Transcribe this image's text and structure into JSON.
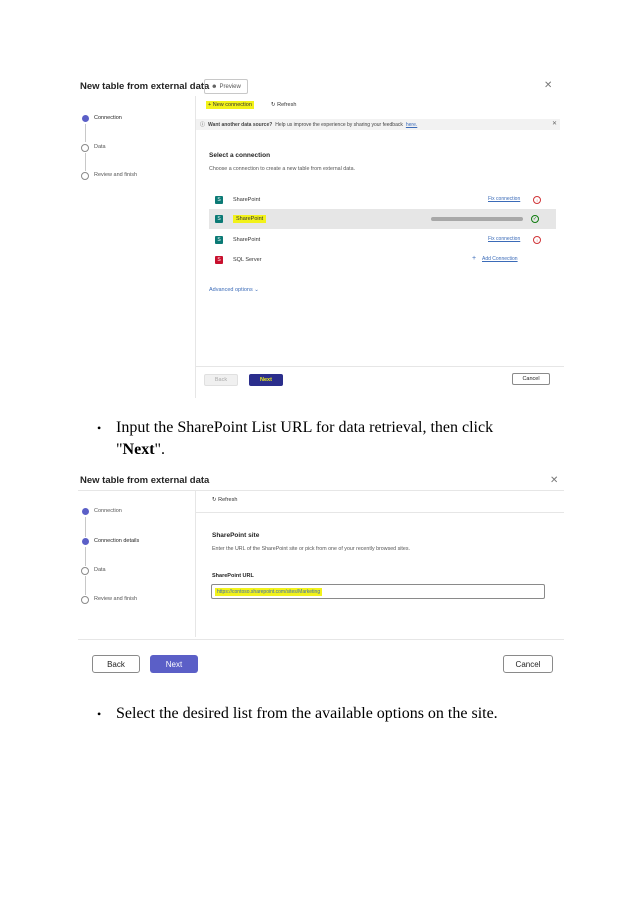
{
  "screenshot1": {
    "title": "New table from external data",
    "preview_label": "Preview",
    "steps": [
      "Connection",
      "Data",
      "Review and finish"
    ],
    "toolbar": {
      "new_connection": "New connection",
      "refresh": "Refresh"
    },
    "banner": {
      "bold": "Want another data source?",
      "text": "Help us improve the experience by sharing your feedback",
      "link": "here."
    },
    "select_title": "Select a connection",
    "select_subtitle": "Choose a connection to create a new table from external data.",
    "connections": [
      {
        "name": "SharePoint",
        "action": "Fix connection",
        "status": "error"
      },
      {
        "name": "SharePoint",
        "action": "",
        "status": "ok"
      },
      {
        "name": "SharePoint",
        "action": "Fix connection",
        "status": "error"
      },
      {
        "name": "SQL Server",
        "action": "Add Connection",
        "status": "add"
      }
    ],
    "advanced_options": "Advanced options",
    "back": "Back",
    "next": "Next",
    "cancel": "Cancel"
  },
  "bullets": [
    {
      "before": "Input the SharePoint List URL for data retrieval, then click",
      "line2_quote_open": "\"",
      "bold": "Next",
      "line2_quote_close": "\"."
    },
    {
      "text": "Select the desired list from the available options on the site."
    }
  ],
  "screenshot2": {
    "title": "New table from external data",
    "steps": [
      "Connection",
      "Connection details",
      "Data",
      "Review and finish"
    ],
    "refresh": "Refresh",
    "site_title": "SharePoint site",
    "site_subtitle": "Enter the URL of the SharePoint site or pick from one of your recently browsed sites.",
    "url_label": "SharePoint URL",
    "url_value": "https://contoso.sharepoint.com/sites/Marketing",
    "back": "Back",
    "next": "Next",
    "cancel": "Cancel"
  },
  "colors": {
    "accent": "#5b5fc7",
    "highlight": "#f2f21a",
    "link": "#3b6bb8",
    "error": "#d13438",
    "success": "#107c10"
  }
}
